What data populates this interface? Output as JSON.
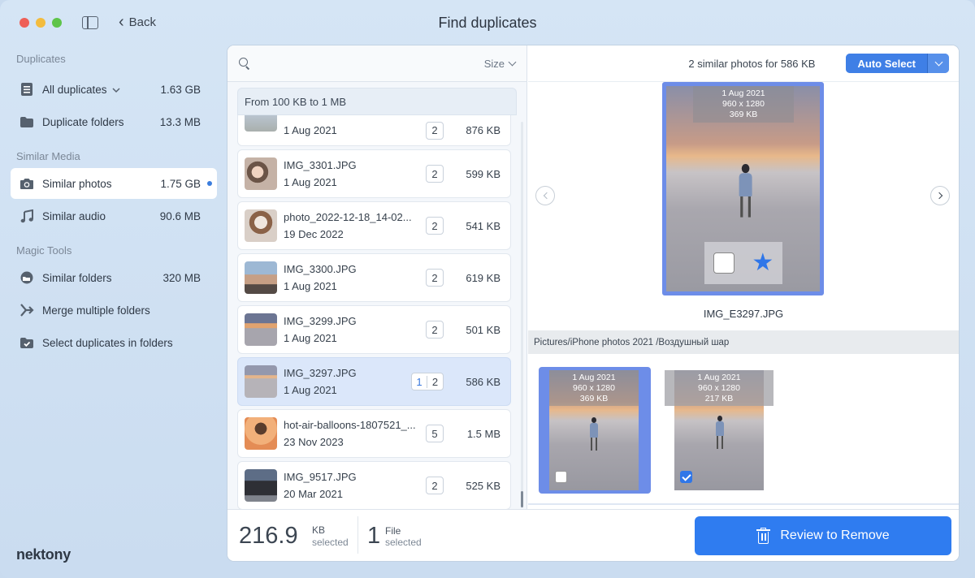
{
  "window": {
    "title": "Find duplicates",
    "back_label": "Back"
  },
  "sidebar": {
    "sections": [
      {
        "title": "Duplicates",
        "items": [
          {
            "label": "All duplicates",
            "size": "1.63 GB",
            "icon": "document-list-icon"
          },
          {
            "label": "Duplicate folders",
            "size": "13.3 MB",
            "icon": "folder-icon"
          }
        ]
      },
      {
        "title": "Similar Media",
        "items": [
          {
            "label": "Similar photos",
            "size": "1.75 GB",
            "icon": "camera-icon"
          },
          {
            "label": "Similar audio",
            "size": "90.6 MB",
            "icon": "music-note-icon"
          }
        ]
      },
      {
        "title": "Magic Tools",
        "items": [
          {
            "label": "Similar folders",
            "size": "320 MB",
            "icon": "similar-folders-icon"
          },
          {
            "label": "Merge multiple folders",
            "size": "",
            "icon": "merge-icon"
          },
          {
            "label": "Select duplicates in folders",
            "size": "",
            "icon": "folder-check-icon"
          }
        ]
      }
    ],
    "logo": "nektony"
  },
  "list": {
    "sort_label": "Size",
    "group_header": "From 100 KB to 1 MB",
    "rows": [
      {
        "name": "",
        "date": "1 Aug 2021",
        "count": "2",
        "size": "876 KB"
      },
      {
        "name": "IMG_3301.JPG",
        "date": "1 Aug 2021",
        "count": "2",
        "size": "599 KB"
      },
      {
        "name": "photo_2022-12-18_14-02...",
        "date": "19 Dec 2022",
        "count": "2",
        "size": "541 KB"
      },
      {
        "name": "IMG_3300.JPG",
        "date": "1 Aug 2021",
        "count": "2",
        "size": "619 KB"
      },
      {
        "name": "IMG_3299.JPG",
        "date": "1 Aug 2021",
        "count": "2",
        "size": "501 KB"
      },
      {
        "name": "IMG_3297.JPG",
        "date": "1 Aug 2021",
        "count_selected": "1",
        "count": "2",
        "size": "586 KB"
      },
      {
        "name": "hot-air-balloons-1807521_...",
        "date": "23 Nov 2023",
        "count": "5",
        "size": "1.5 MB"
      },
      {
        "name": "IMG_9517.JPG",
        "date": "20 Mar 2021",
        "count": "2",
        "size": "525 KB"
      }
    ]
  },
  "preview": {
    "similar_count": "2 similar photos for 586 KB",
    "auto_select_label": "Auto Select",
    "main": {
      "date": "1 Aug 2021",
      "dims": "960 x 1280",
      "size": "369 KB",
      "name": "IMG_E3297.JPG"
    },
    "path": "Pictures/iPhone photos 2021 /Воздушный шар",
    "thumbs": [
      {
        "date": "1 Aug 2021",
        "dims": "960 x 1280",
        "size": "369 KB",
        "checked": false
      },
      {
        "date": "1 Aug 2021",
        "dims": "960 x 1280",
        "size": "217 KB",
        "checked": true
      }
    ]
  },
  "footer": {
    "selected_size": "216.9",
    "selected_unit": "KB",
    "selected_label": "selected",
    "files_count": "1",
    "files_unit": "File",
    "files_label": "selected",
    "review_label": "Review to Remove"
  }
}
